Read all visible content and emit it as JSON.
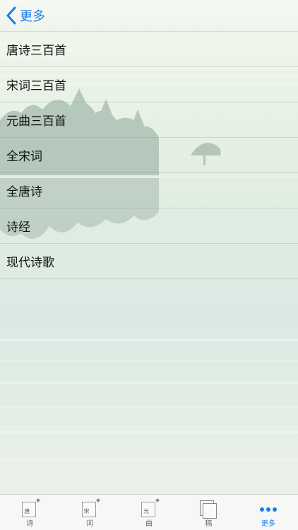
{
  "navbar": {
    "back_label": "更多"
  },
  "list": {
    "items": [
      {
        "label": "唐诗三百首"
      },
      {
        "label": "宋词三百首"
      },
      {
        "label": "元曲三百首"
      },
      {
        "label": "全宋词"
      },
      {
        "label": "全唐诗"
      },
      {
        "label": "诗经"
      },
      {
        "label": "现代诗歌"
      }
    ]
  },
  "tabbar": {
    "tabs": [
      {
        "label": "诗",
        "glyph": "唐",
        "icon": "document-pen-icon"
      },
      {
        "label": "词",
        "glyph": "宋",
        "icon": "document-pen-icon"
      },
      {
        "label": "曲",
        "glyph": "元",
        "icon": "document-pen-icon"
      },
      {
        "label": "稿",
        "icon": "stacked-sheets-icon"
      },
      {
        "label": "更多",
        "icon": "more-dots-icon",
        "active": true
      }
    ]
  },
  "colors": {
    "accent": "#1a7bf0"
  }
}
